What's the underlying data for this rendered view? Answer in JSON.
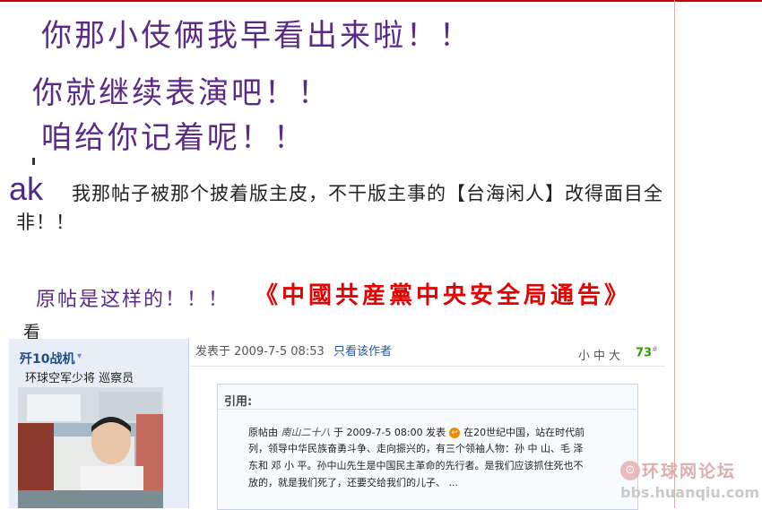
{
  "headline": {
    "line1": "你那小伎俩我早看出来啦！！",
    "line2": "你就继续表演吧！！",
    "line3": "咱给你记着呢！！"
  },
  "complaint": {
    "prefix": "ak",
    "line1": "我那帖子被那个披着版主皮，不干版主事的【台海闲人】改得面目全",
    "line2": "非！！"
  },
  "original": {
    "intro": "原帖是这样的！！！",
    "red_title": "《中國共産黨中央安全局通告》",
    "kan": "看"
  },
  "forum": {
    "username": "歼10战机",
    "rank": "环球空军少将 巡察员",
    "posted_at": "发表于  2009-7-5 08:53",
    "only_author": "只看该作者",
    "font_sizes": "小中大",
    "floor": "73",
    "floor_mark": "#",
    "quote_label": "引用:",
    "quote_lines": {
      "l1_a": "原帖由",
      "l1_author": "南山二十八",
      "l1_b": "于  2009-7-5 08:00 发表",
      "l1_c": "在20世纪中国，站在时代前",
      "l2": "列，领导中华民族奋勇斗争、走向振兴的，有三个领袖人物：孙  中  山、毛  泽",
      "l3": "东和  邓  小  平。孙中山先生是中国民主革命的先行者。是我们应该抓住死也不",
      "l4": "放的，就是我们死了，还要交给我们的儿子、  ..."
    }
  },
  "watermark": {
    "name": "环球网论坛",
    "url": "bbs.huanqiu.com"
  },
  "colors": {
    "headline": "#5b2a86",
    "red_title": "#e60000",
    "link": "#1e5bb0",
    "floor": "#339900"
  }
}
